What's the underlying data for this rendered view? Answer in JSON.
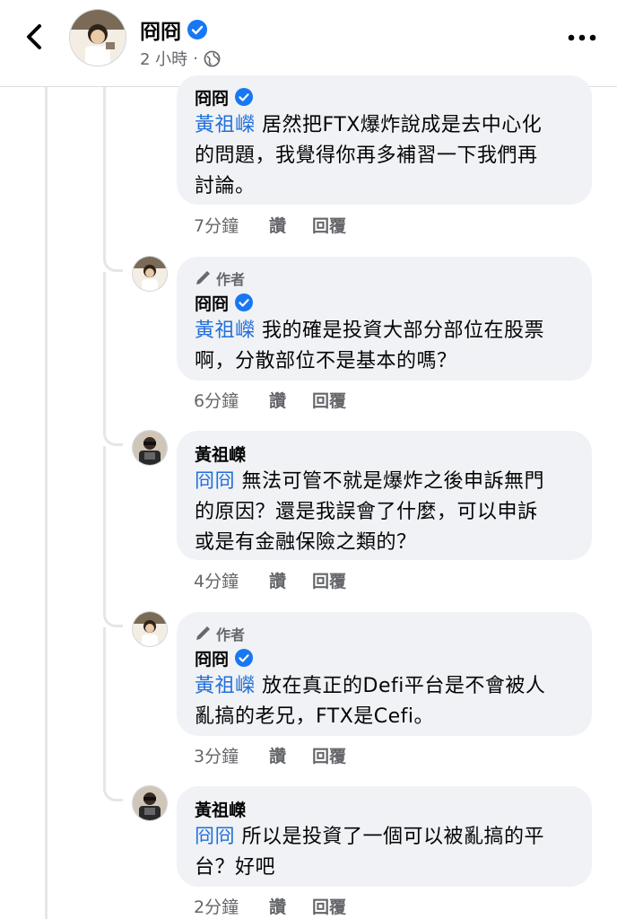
{
  "header": {
    "author_name": "冏冏",
    "post_time": "2 小時",
    "separator": "·"
  },
  "comments": [
    {
      "is_author": false,
      "author_tag": "",
      "name": "冏冏",
      "mention": "黃祖嶸",
      "lines": [
        "居然把FTX爆炸說成是去中心化",
        "的問題，我覺得你再多補習一下我們再",
        "討論。"
      ],
      "time": "7分鐘",
      "like": "讚",
      "reply": "回覆"
    },
    {
      "is_author": true,
      "author_tag": "作者",
      "name": "冏冏",
      "mention": "黃祖嶸",
      "lines": [
        "我的確是投資大部分部位在股票",
        "啊，分散部位不是基本的嗎？"
      ],
      "time": "6分鐘",
      "like": "讚",
      "reply": "回覆"
    },
    {
      "is_author": false,
      "author_tag": "",
      "name": "黃祖嶸",
      "mention": "冏冏",
      "lines": [
        "無法可管不就是爆炸之後申訴無門",
        "的原因？還是我誤會了什麼，可以申訴",
        "或是有金融保險之類的？"
      ],
      "time": "4分鐘",
      "like": "讚",
      "reply": "回覆"
    },
    {
      "is_author": true,
      "author_tag": "作者",
      "name": "冏冏",
      "mention": "黃祖嶸",
      "lines": [
        "放在真正的Defi平台是不會被人",
        "亂搞的老兄，FTX是Cefi。"
      ],
      "time": "3分鐘",
      "like": "讚",
      "reply": "回覆"
    },
    {
      "is_author": false,
      "author_tag": "",
      "name": "黃祖嶸",
      "mention": "冏冏",
      "lines": [
        "所以是投資了一個可以被亂搞的平",
        "台？好吧"
      ],
      "time": "2分鐘",
      "like": "讚",
      "reply": "回覆"
    }
  ],
  "colors": {
    "mention": "#216fdb",
    "verified": "#1877f2",
    "bubble": "#f0f2f5",
    "meta_text": "#65676b"
  },
  "icons": [
    "back-chevron-icon",
    "verified-badge-icon",
    "globe-icon",
    "more-dots-icon",
    "pen-icon"
  ]
}
